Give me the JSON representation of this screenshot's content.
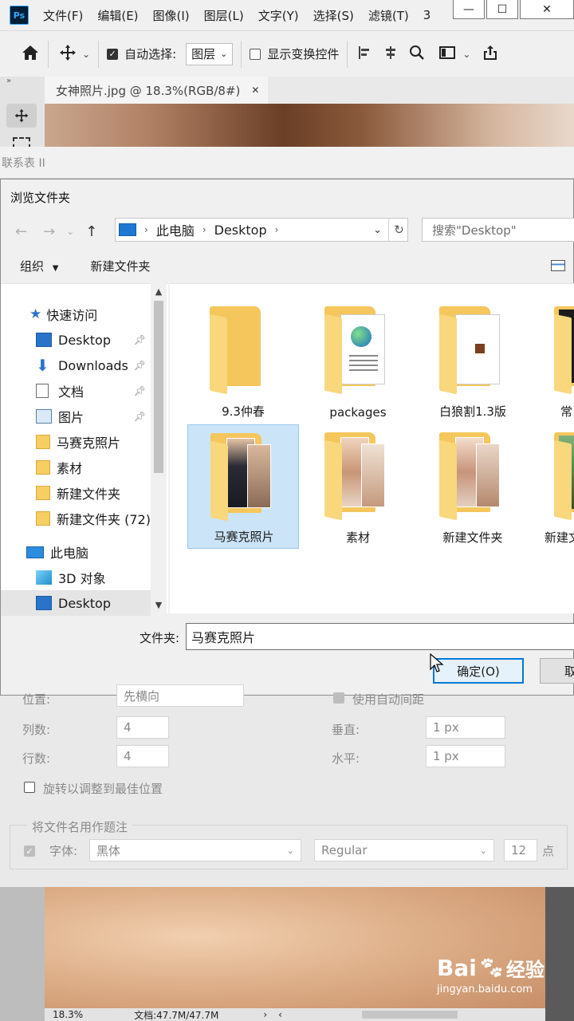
{
  "menubar": {
    "logo": "Ps",
    "items": [
      "文件(F)",
      "编辑(E)",
      "图像(I)",
      "图层(L)",
      "文字(Y)",
      "选择(S)",
      "滤镜(T)",
      "3"
    ],
    "win_min": "—",
    "win_max": "☐",
    "win_close": "✕"
  },
  "options": {
    "auto_select_label": "自动选择:",
    "layer_select": "图层",
    "transform_label": "显示变换控件"
  },
  "doc_tab": {
    "title": "女神照片.jpg @ 18.3%(RGB/8#)",
    "close": "✕"
  },
  "panel_strip": {
    "label": "联系表 II"
  },
  "dialog": {
    "title": "浏览文件夹",
    "breadcrumb": [
      "此电脑",
      "Desktop"
    ],
    "search_placeholder": "搜索\"Desktop\"",
    "organize": "组织",
    "new_folder": "新建文件夹",
    "nav": [
      {
        "label": "快速访问",
        "kind": "star"
      },
      {
        "label": "Desktop",
        "kind": "blue",
        "pinned": true
      },
      {
        "label": "Downloads",
        "kind": "download",
        "pinned": true
      },
      {
        "label": "文档",
        "kind": "doc",
        "pinned": true
      },
      {
        "label": "图片",
        "kind": "pic",
        "pinned": true
      },
      {
        "label": "马赛克照片",
        "kind": "folder"
      },
      {
        "label": "素材",
        "kind": "folder"
      },
      {
        "label": "新建文件夹",
        "kind": "folder"
      },
      {
        "label": "新建文件夹 (72)",
        "kind": "folder"
      },
      {
        "label": "此电脑",
        "kind": "pc"
      },
      {
        "label": "3D 对象",
        "kind": "cube"
      },
      {
        "label": "Desktop",
        "kind": "blue"
      }
    ],
    "files": [
      {
        "label": "9.3仲春"
      },
      {
        "label": "packages"
      },
      {
        "label": "白狼割1.3版"
      },
      {
        "label": "常"
      },
      {
        "label": "马赛克照片",
        "selected": true
      },
      {
        "label": "素材"
      },
      {
        "label": "新建文件夹"
      },
      {
        "label": "新建文"
      }
    ],
    "folder_label": "文件夹:",
    "folder_value": "马赛克照片",
    "ok": "确定(O)",
    "cancel": "取"
  },
  "settings": {
    "position_label": "位置:",
    "position_value": "先横向",
    "auto_spacing": "使用自动间距",
    "cols_label": "列数:",
    "cols_value": "4",
    "rows_label": "行数:",
    "rows_value": "4",
    "vert_label": "垂直:",
    "vert_value": "1 px",
    "horiz_label": "水平:",
    "horiz_value": "1 px",
    "rotate_label": "旋转以调整到最佳位置",
    "caption_group": "将文件名用作题注",
    "font_label": "字体:",
    "font_value": "黑体",
    "style_value": "Regular",
    "size_value": "12",
    "size_unit": "点"
  },
  "status": {
    "zoom": "18.3%",
    "doc": "文档:47.7M/47.7M"
  },
  "watermark": {
    "brand": "Bai",
    "brand2": "经验",
    "url": "jingyan.baidu.com"
  }
}
